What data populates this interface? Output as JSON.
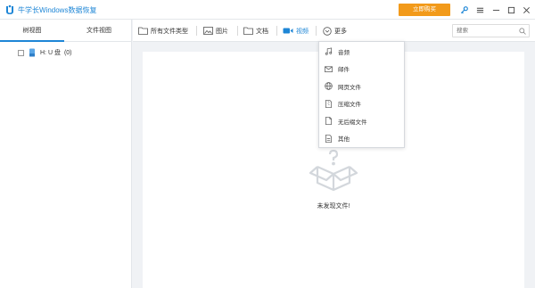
{
  "window": {
    "title": "牛学长Windows数据恢复",
    "buy_label": "立即购买",
    "accent": "#1e86d6",
    "buy_color": "#f29a1a"
  },
  "left_panel": {
    "tabs": [
      {
        "label": "树视图",
        "active": true
      },
      {
        "label": "文件视图",
        "active": false
      }
    ],
    "tree": [
      {
        "label": "H: U 盘",
        "count": "(0)",
        "checked": false
      }
    ]
  },
  "toolbar": {
    "items": [
      {
        "label": "所有文件类型",
        "icon": "folder-icon"
      },
      {
        "label": "图片",
        "icon": "image-icon"
      },
      {
        "label": "文档",
        "icon": "folder-icon"
      },
      {
        "label": "视频",
        "icon": "video-icon",
        "active": true
      },
      {
        "label": "更多",
        "icon": "chevron-circle-icon"
      }
    ],
    "search_placeholder": "搜索"
  },
  "more_menu": {
    "items": [
      {
        "label": "音频",
        "icon": "music-icon"
      },
      {
        "label": "邮件",
        "icon": "mail-icon"
      },
      {
        "label": "网页文件",
        "icon": "globe-icon"
      },
      {
        "label": "压缩文件",
        "icon": "archive-icon"
      },
      {
        "label": "无后缀文件",
        "icon": "file-icon"
      },
      {
        "label": "其他",
        "icon": "other-file-icon"
      }
    ]
  },
  "content": {
    "empty_message": "未发现文件!"
  }
}
